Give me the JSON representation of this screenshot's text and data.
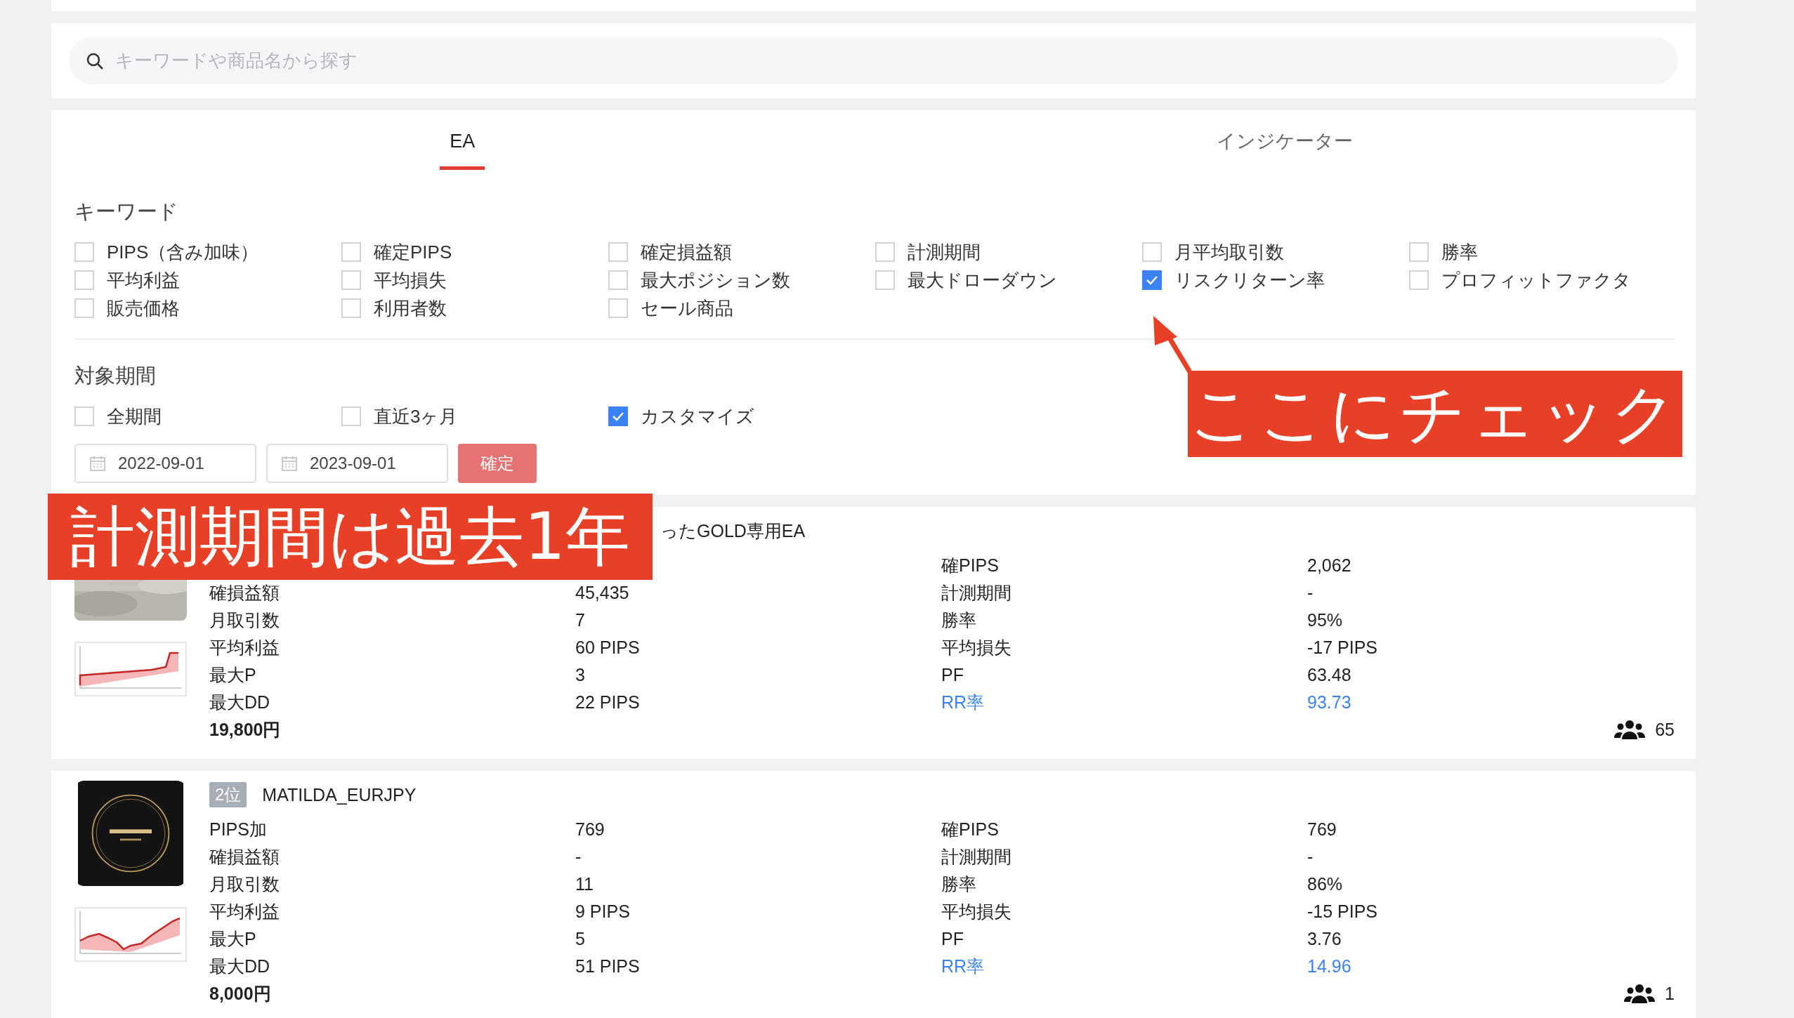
{
  "search": {
    "placeholder": "キーワードや商品名から探す"
  },
  "tabs": [
    {
      "label": "EA",
      "selected": true
    },
    {
      "label": "インジケーター",
      "selected": false
    }
  ],
  "keyword_filter": {
    "heading": "キーワード",
    "options": [
      {
        "label": "PIPS（含み加味）",
        "checked": false
      },
      {
        "label": "確定PIPS",
        "checked": false
      },
      {
        "label": "確定損益額",
        "checked": false
      },
      {
        "label": "計測期間",
        "checked": false
      },
      {
        "label": "月平均取引数",
        "checked": false
      },
      {
        "label": "勝率",
        "checked": false
      },
      {
        "label": "平均利益",
        "checked": false
      },
      {
        "label": "平均損失",
        "checked": false
      },
      {
        "label": "最大ポジション数",
        "checked": false
      },
      {
        "label": "最大ドローダウン",
        "checked": false
      },
      {
        "label": "リスクリターン率",
        "checked": true
      },
      {
        "label": "プロフィットファクタ",
        "checked": false
      },
      {
        "label": "販売価格",
        "checked": false
      },
      {
        "label": "利用者数",
        "checked": false
      },
      {
        "label": "セール商品",
        "checked": false
      }
    ]
  },
  "period_filter": {
    "heading": "対象期間",
    "options": [
      {
        "label": "全期間",
        "checked": false
      },
      {
        "label": "直近3ヶ月",
        "checked": false
      },
      {
        "label": "カスタマイズ",
        "checked": true
      }
    ],
    "date_from": "2022-09-01",
    "date_to": "2023-09-01",
    "confirm_button": "確定"
  },
  "products": [
    {
      "title": "ったGOLD専用EA",
      "rows": [
        {
          "label_2": "確PIPS",
          "value_2": "2,062",
          "highlighted": false
        },
        {
          "label_1": "確損益額",
          "value_1": "45,435",
          "label_2": "計測期間",
          "value_2": "-",
          "highlighted": false
        },
        {
          "label_1": "月取引数",
          "value_1": "7",
          "label_2": "勝率",
          "value_2": "95%",
          "highlighted": false
        },
        {
          "label_1": "平均利益",
          "value_1": "60 PIPS",
          "label_2": "平均損失",
          "value_2": "-17 PIPS",
          "highlighted": false
        },
        {
          "label_1": "最大P",
          "value_1": "3",
          "label_2": "PF",
          "value_2": "63.48",
          "highlighted": false
        },
        {
          "label_1": "最大DD",
          "value_1": "22 PIPS",
          "label_2": "RR率",
          "value_2": "93.73",
          "highlighted": true
        }
      ],
      "price": "19,800円",
      "users": "65"
    },
    {
      "rank": "2位",
      "title": "MATILDA_EURJPY",
      "rows": [
        {
          "label_1": "PIPS加",
          "value_1": "769",
          "label_2": "確PIPS",
          "value_2": "769",
          "highlighted": false
        },
        {
          "label_1": "確損益額",
          "value_1": "-",
          "label_2": "計測期間",
          "value_2": "-",
          "highlighted": false
        },
        {
          "label_1": "月取引数",
          "value_1": "11",
          "label_2": "勝率",
          "value_2": "86%",
          "highlighted": false
        },
        {
          "label_1": "平均利益",
          "value_1": "9 PIPS",
          "label_2": "平均損失",
          "value_2": "-15 PIPS",
          "highlighted": false
        },
        {
          "label_1": "最大P",
          "value_1": "5",
          "label_2": "PF",
          "value_2": "3.76",
          "highlighted": false
        },
        {
          "label_1": "最大DD",
          "value_1": "51 PIPS",
          "label_2": "RR率",
          "value_2": "14.96",
          "highlighted": true
        }
      ],
      "price": "8,000円",
      "users": "1"
    }
  ],
  "annotations": [
    {
      "kind": "arrow_callout",
      "text": "ここにチェック"
    },
    {
      "kind": "callout",
      "text": "計測期間は過去1年"
    }
  ]
}
